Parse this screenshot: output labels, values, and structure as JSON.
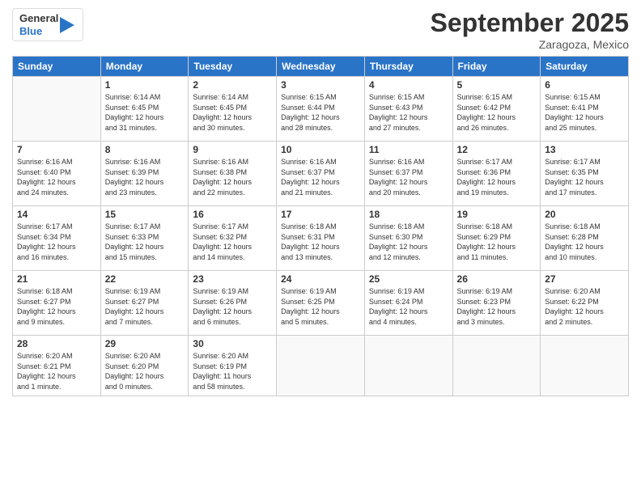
{
  "header": {
    "logo_line1": "General",
    "logo_line2": "Blue",
    "month_title": "September 2025",
    "location": "Zaragoza, Mexico"
  },
  "weekdays": [
    "Sunday",
    "Monday",
    "Tuesday",
    "Wednesday",
    "Thursday",
    "Friday",
    "Saturday"
  ],
  "weeks": [
    [
      {
        "day": "",
        "info": ""
      },
      {
        "day": "1",
        "info": "Sunrise: 6:14 AM\nSunset: 6:45 PM\nDaylight: 12 hours\nand 31 minutes."
      },
      {
        "day": "2",
        "info": "Sunrise: 6:14 AM\nSunset: 6:45 PM\nDaylight: 12 hours\nand 30 minutes."
      },
      {
        "day": "3",
        "info": "Sunrise: 6:15 AM\nSunset: 6:44 PM\nDaylight: 12 hours\nand 28 minutes."
      },
      {
        "day": "4",
        "info": "Sunrise: 6:15 AM\nSunset: 6:43 PM\nDaylight: 12 hours\nand 27 minutes."
      },
      {
        "day": "5",
        "info": "Sunrise: 6:15 AM\nSunset: 6:42 PM\nDaylight: 12 hours\nand 26 minutes."
      },
      {
        "day": "6",
        "info": "Sunrise: 6:15 AM\nSunset: 6:41 PM\nDaylight: 12 hours\nand 25 minutes."
      }
    ],
    [
      {
        "day": "7",
        "info": "Sunrise: 6:16 AM\nSunset: 6:40 PM\nDaylight: 12 hours\nand 24 minutes."
      },
      {
        "day": "8",
        "info": "Sunrise: 6:16 AM\nSunset: 6:39 PM\nDaylight: 12 hours\nand 23 minutes."
      },
      {
        "day": "9",
        "info": "Sunrise: 6:16 AM\nSunset: 6:38 PM\nDaylight: 12 hours\nand 22 minutes."
      },
      {
        "day": "10",
        "info": "Sunrise: 6:16 AM\nSunset: 6:37 PM\nDaylight: 12 hours\nand 21 minutes."
      },
      {
        "day": "11",
        "info": "Sunrise: 6:16 AM\nSunset: 6:37 PM\nDaylight: 12 hours\nand 20 minutes."
      },
      {
        "day": "12",
        "info": "Sunrise: 6:17 AM\nSunset: 6:36 PM\nDaylight: 12 hours\nand 19 minutes."
      },
      {
        "day": "13",
        "info": "Sunrise: 6:17 AM\nSunset: 6:35 PM\nDaylight: 12 hours\nand 17 minutes."
      }
    ],
    [
      {
        "day": "14",
        "info": "Sunrise: 6:17 AM\nSunset: 6:34 PM\nDaylight: 12 hours\nand 16 minutes."
      },
      {
        "day": "15",
        "info": "Sunrise: 6:17 AM\nSunset: 6:33 PM\nDaylight: 12 hours\nand 15 minutes."
      },
      {
        "day": "16",
        "info": "Sunrise: 6:17 AM\nSunset: 6:32 PM\nDaylight: 12 hours\nand 14 minutes."
      },
      {
        "day": "17",
        "info": "Sunrise: 6:18 AM\nSunset: 6:31 PM\nDaylight: 12 hours\nand 13 minutes."
      },
      {
        "day": "18",
        "info": "Sunrise: 6:18 AM\nSunset: 6:30 PM\nDaylight: 12 hours\nand 12 minutes."
      },
      {
        "day": "19",
        "info": "Sunrise: 6:18 AM\nSunset: 6:29 PM\nDaylight: 12 hours\nand 11 minutes."
      },
      {
        "day": "20",
        "info": "Sunrise: 6:18 AM\nSunset: 6:28 PM\nDaylight: 12 hours\nand 10 minutes."
      }
    ],
    [
      {
        "day": "21",
        "info": "Sunrise: 6:18 AM\nSunset: 6:27 PM\nDaylight: 12 hours\nand 9 minutes."
      },
      {
        "day": "22",
        "info": "Sunrise: 6:19 AM\nSunset: 6:27 PM\nDaylight: 12 hours\nand 7 minutes."
      },
      {
        "day": "23",
        "info": "Sunrise: 6:19 AM\nSunset: 6:26 PM\nDaylight: 12 hours\nand 6 minutes."
      },
      {
        "day": "24",
        "info": "Sunrise: 6:19 AM\nSunset: 6:25 PM\nDaylight: 12 hours\nand 5 minutes."
      },
      {
        "day": "25",
        "info": "Sunrise: 6:19 AM\nSunset: 6:24 PM\nDaylight: 12 hours\nand 4 minutes."
      },
      {
        "day": "26",
        "info": "Sunrise: 6:19 AM\nSunset: 6:23 PM\nDaylight: 12 hours\nand 3 minutes."
      },
      {
        "day": "27",
        "info": "Sunrise: 6:20 AM\nSunset: 6:22 PM\nDaylight: 12 hours\nand 2 minutes."
      }
    ],
    [
      {
        "day": "28",
        "info": "Sunrise: 6:20 AM\nSunset: 6:21 PM\nDaylight: 12 hours\nand 1 minute."
      },
      {
        "day": "29",
        "info": "Sunrise: 6:20 AM\nSunset: 6:20 PM\nDaylight: 12 hours\nand 0 minutes."
      },
      {
        "day": "30",
        "info": "Sunrise: 6:20 AM\nSunset: 6:19 PM\nDaylight: 11 hours\nand 58 minutes."
      },
      {
        "day": "",
        "info": ""
      },
      {
        "day": "",
        "info": ""
      },
      {
        "day": "",
        "info": ""
      },
      {
        "day": "",
        "info": ""
      }
    ]
  ]
}
